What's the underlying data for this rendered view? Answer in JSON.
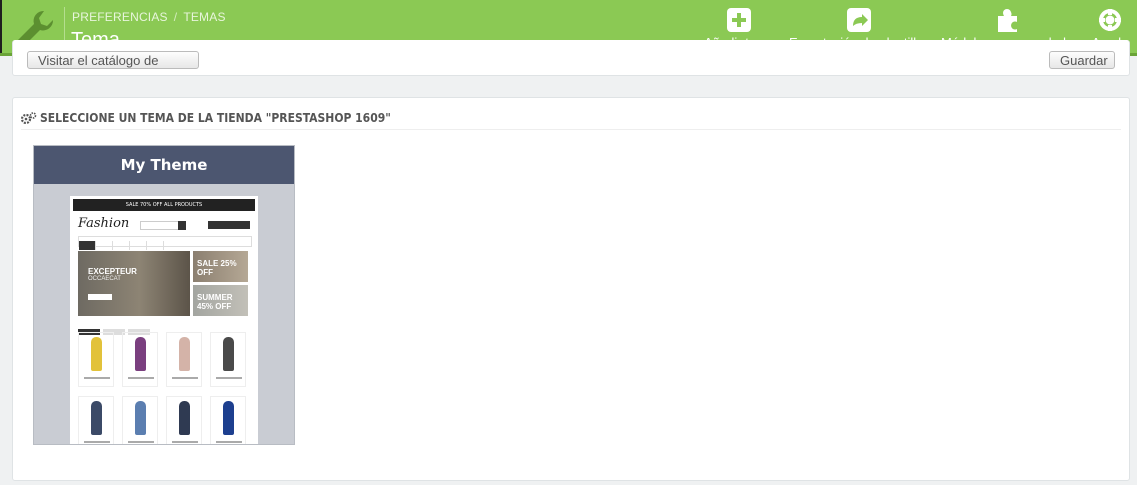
{
  "header": {
    "breadcrumb": [
      "PREFERENCIAS",
      "TEMAS"
    ],
    "breadcrumb_sep": "/",
    "title": "Tema",
    "buttons": [
      {
        "label": "Añadir tema",
        "icon": "plus-square-icon"
      },
      {
        "label": "Exportación de plantillas",
        "icon": "share-square-icon"
      },
      {
        "label": "Módulos recomendados",
        "icon": "puzzle-icon"
      },
      {
        "label": "Ayuda",
        "icon": "life-ring-icon"
      }
    ],
    "colors": {
      "bar": "#8bc954",
      "bar_border": "#6aa338"
    }
  },
  "top_panel": {
    "left_button": "Visitar el catálogo de temas",
    "right_button": "Guardar"
  },
  "theme_panel": {
    "heading": "SELECCIONE UN TEMA DE LA TIENDA \"PRESTASHOP 1609\"",
    "heading_icon": "cogs-icon",
    "theme": {
      "name": "My Theme",
      "preview": {
        "banner": "SALE 70% OFF ALL PRODUCTS",
        "logo": "Fashion",
        "hero_title": "EXCEPTEUR",
        "hero_sub": "OCCAECAT",
        "promo1": "SALE 25% OFF",
        "promo2": "SUMMER 45% OFF"
      }
    }
  }
}
